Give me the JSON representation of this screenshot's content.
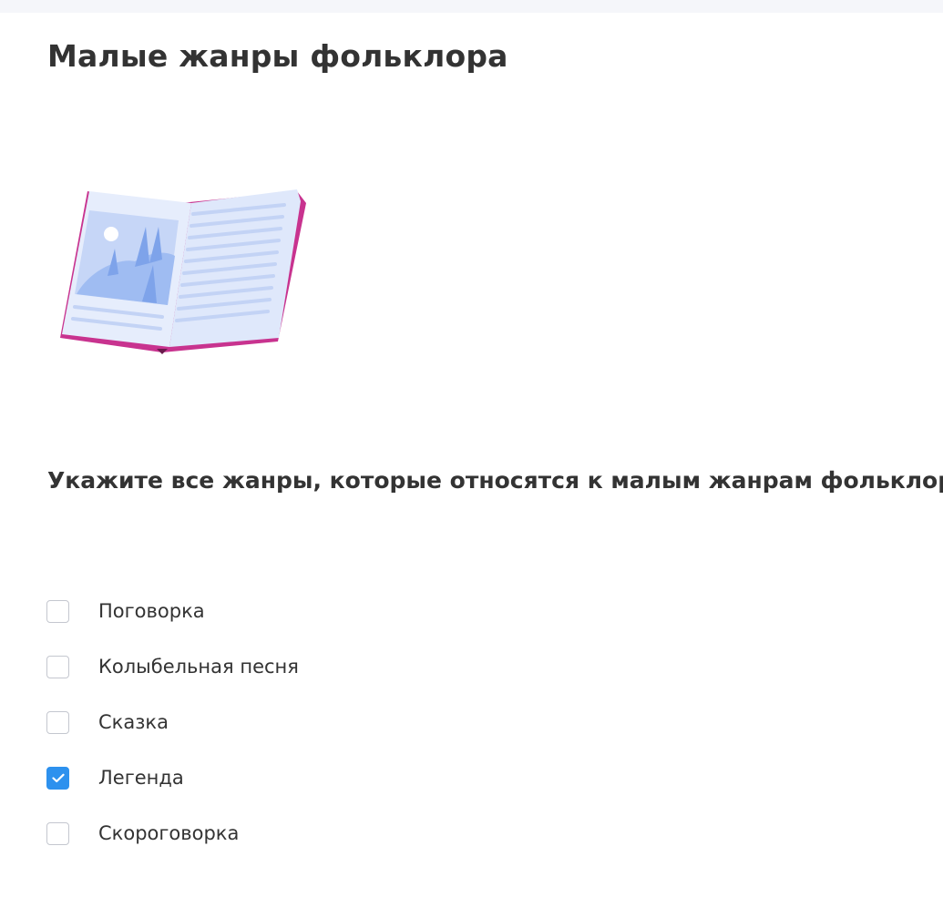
{
  "page": {
    "title": "Малые жанры фольклора"
  },
  "question": {
    "text": "Укажите все жанры, которые относятся к малым жанрам фольклора."
  },
  "options": [
    {
      "label": "Поговорка",
      "checked": false
    },
    {
      "label": "Колыбельная песня",
      "checked": false
    },
    {
      "label": "Сказка",
      "checked": false
    },
    {
      "label": "Легенда",
      "checked": true
    },
    {
      "label": "Скороговорка",
      "checked": false
    }
  ],
  "colors": {
    "accent": "#2d91ee",
    "book_cover": "#c8338f",
    "book_page": "#dfe8fb",
    "text": "#333333"
  },
  "icons": {
    "illustration": "open-book-icon",
    "check": "checkmark-icon"
  }
}
